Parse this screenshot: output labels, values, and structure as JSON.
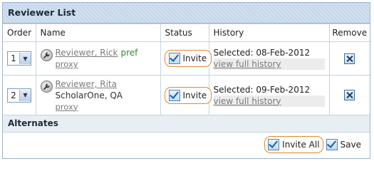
{
  "panel": {
    "title": "Reviewer List"
  },
  "columns": {
    "order": "Order",
    "name": "Name",
    "status": "Status",
    "history": "History",
    "remove": "Remove"
  },
  "reviewers": [
    {
      "order": "1",
      "name": "Reviewer, Rick",
      "pref": "pref",
      "organization": "",
      "proxy": "proxy",
      "status": "Invite",
      "selected": "Selected: 08-Feb-2012",
      "history_link": "view full history"
    },
    {
      "order": "2",
      "name": "Reviewer, Rita",
      "pref": "",
      "organization": "ScholarOne, QA",
      "proxy": "proxy",
      "status": "Invite",
      "selected": "Selected: 09-Feb-2012",
      "history_link": "view full history"
    }
  ],
  "alternates": {
    "title": "Alternates"
  },
  "footer": {
    "invite_all": "Invite All",
    "save": "Save"
  },
  "colors": {
    "header_bg": "#c7d8ea",
    "highlight_border": "#e08a2c",
    "link": "#7b7b7b",
    "pref": "#2f8a2f"
  },
  "icons": {
    "reviewer": "wrench-icon",
    "remove": "close-icon",
    "dropdown": "chevron-down-icon",
    "check": "checkbox-icon"
  }
}
